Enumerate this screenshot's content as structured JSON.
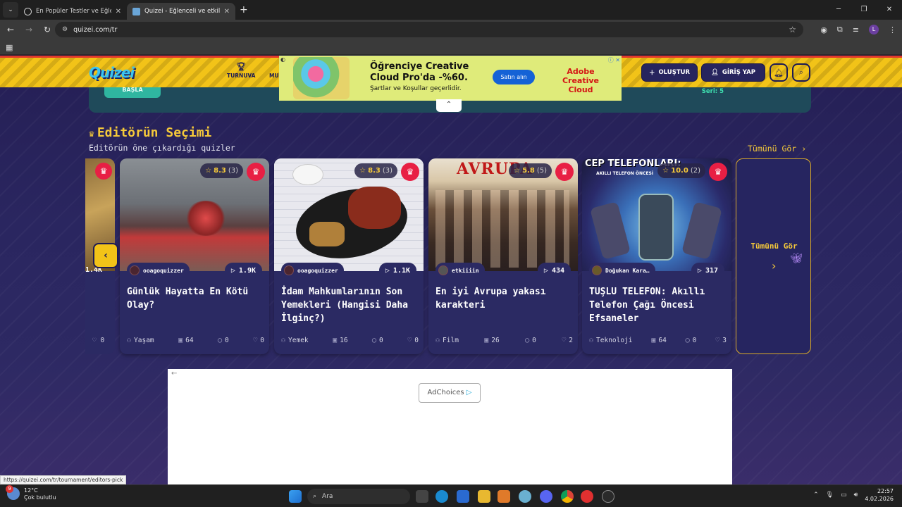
{
  "browser": {
    "tabs": [
      {
        "title": "En Popüler Testler ve Eğlenceli",
        "active": false
      },
      {
        "title": "Quizei - Eğlenceli ve etkileşimli",
        "active": true
      }
    ],
    "new_tab": "+",
    "url": "quizei.com/tr",
    "avatar_letter": "L",
    "status_url": "https://quizei.com/tr/tournament/editors-pick"
  },
  "site": {
    "logo": "Quizei",
    "nav": [
      {
        "label": "TURNUVA",
        "icon": "trophy-icon"
      },
      {
        "label": "MU"
      }
    ],
    "create_button": "OLUŞTUR",
    "login_button": "GİRİŞ YAP",
    "banner_button": "BAŞLA",
    "banner_seri": "Seri: 5"
  },
  "ad_top": {
    "headline": "Öğrenciye Creative Cloud Pro'da -%60.",
    "sub": "Şartlar ve Koşullar geçerlidir.",
    "cta": "Satın alın",
    "brand": "Adobe Creative Cloud"
  },
  "section": {
    "title": "Editörün Seçimi",
    "subtitle": "Editörün öne çıkardığı quizler",
    "see_all": "Tümünü Gör",
    "see_all_card": "Tümünü Gör",
    "partial_card": {
      "plays": "1.4K",
      "likes": "0"
    }
  },
  "cards": [
    {
      "title": "Günlük Hayatta En Kötü Olay?",
      "rating": "8.3",
      "rating_count": "(3)",
      "author": "ooagoquizzer",
      "plays": "1.9K",
      "category": "Yaşam",
      "questions": "64",
      "comments": "0",
      "likes": "0"
    },
    {
      "title": "İdam Mahkumlarının Son Yemekleri (Hangisi Daha İlginç?)",
      "rating": "8.3",
      "rating_count": "(3)",
      "author": "ooagoquizzer",
      "plays": "1.1K",
      "category": "Yemek",
      "questions": "16",
      "comments": "0",
      "likes": "0"
    },
    {
      "title": "En iyi Avrupa yakası karakteri",
      "rating": "5.8",
      "rating_count": "(5)",
      "author": "etkiiiin",
      "plays": "434",
      "category": "Film",
      "questions": "26",
      "comments": "0",
      "likes": "2"
    },
    {
      "title": "TUŞLU TELEFON: Akıllı Telefon Çağı Öncesi Efsaneler",
      "rating": "10.0",
      "rating_count": "(2)",
      "author": "Doğukan Kara…",
      "plays": "317",
      "category": "Teknoloji",
      "questions": "64",
      "comments": "0",
      "likes": "3"
    }
  ],
  "card_images": {
    "avrupa": "AVRUPA",
    "cep": "CEP TELEFONLARI:",
    "cep_sub": "AKILLI TELEFON ÖNCESİ"
  },
  "ad_bottom": {
    "adchoices": "AdChoices"
  },
  "taskbar": {
    "weather_temp": "12°C",
    "weather_desc": "Çok bulutlu",
    "weather_badge": "9",
    "search_label": "Ara",
    "time": "22:57",
    "date": "4.02.2026"
  },
  "colors": {
    "accent_yellow": "#f2c318",
    "crown_red": "#e81f44",
    "card_bg": "#2b2a63",
    "header_border": "#e23a2a"
  }
}
